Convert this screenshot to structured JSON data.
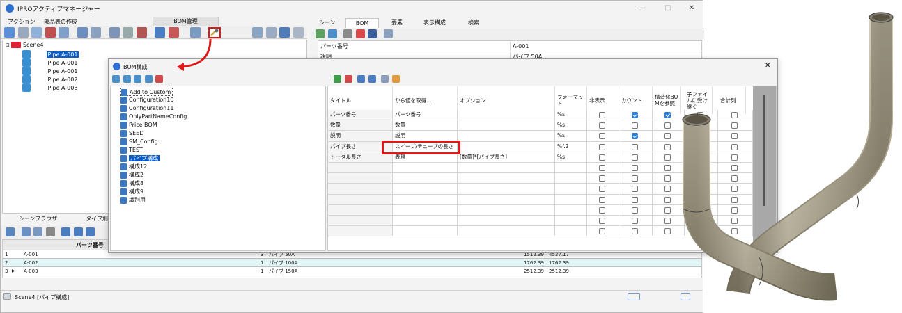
{
  "window": {
    "title": "IPROアクティブマネージャー",
    "controls": {
      "min": "—",
      "max": "□",
      "close": "✕"
    }
  },
  "menu": {
    "items": [
      "アクション",
      "部品表の作成"
    ],
    "bom_tab": "BOM管理"
  },
  "right_tabs": [
    "シーン",
    "BOM",
    "要素",
    "表示構成",
    "検索"
  ],
  "tree": {
    "root": "Scene4",
    "items": [
      "Pipe A-001",
      "Pipe A-001",
      "Pipe A-001",
      "Pipe A-002",
      "Pipe A-003"
    ]
  },
  "props": {
    "rows": [
      {
        "key": "パーツ番号",
        "value": "A-001"
      },
      {
        "key": "説明",
        "value": "パイプ 50A"
      }
    ]
  },
  "bottom_tabs": [
    "シーンブラウザ",
    "タイプ別"
  ],
  "grid": {
    "header": "パーツ番号",
    "rows": [
      {
        "no": "1",
        "part": "A-001",
        "qty": "3",
        "desc": "パイプ 50A",
        "len": "1512.39",
        "total": "4537.17"
      },
      {
        "no": "2",
        "part": "A-002",
        "qty": "1",
        "desc": "パイプ 100A",
        "len": "1762.39",
        "total": "1762.39"
      },
      {
        "no": "3",
        "part": "A-003",
        "qty": "1",
        "desc": "パイプ 150A",
        "len": "2512.39",
        "total": "2512.39"
      }
    ]
  },
  "status": {
    "text": "Scene4 [パイプ構成]"
  },
  "dialog": {
    "title": "BOM構成",
    "close": "✕",
    "configs": [
      "Add to Custom",
      "Configuration10",
      "Configuration11",
      "OnlyPartNameConfig",
      "Price BOM",
      "SEED",
      "SM_Config",
      "TEST",
      "パイプ構成",
      "構成12",
      "構成2",
      "構成8",
      "構成9",
      "識別用"
    ],
    "selected_config": "パイプ構成",
    "columns": [
      "タイトル",
      "から値を取得…",
      "オプション",
      "フォーマット",
      "非表示",
      "カウント",
      "構造化BOMを参照",
      "子ファイルに受け継ぐ",
      "合計列"
    ],
    "rows": [
      {
        "title": "パーツ番号",
        "source": "パーツ番号",
        "option": "",
        "format": "%s",
        "hide": false,
        "count": true,
        "struct": true,
        "child": false,
        "sum": false
      },
      {
        "title": "数量",
        "source": "数量",
        "option": "",
        "format": "%s",
        "hide": false,
        "count": false,
        "struct": false,
        "child": false,
        "sum": false
      },
      {
        "title": "説明",
        "source": "説明",
        "option": "",
        "format": "%s",
        "hide": false,
        "count": true,
        "struct": false,
        "child": false,
        "sum": false
      },
      {
        "title": "パイプ長さ",
        "source": "スイープ/チューブの長さ",
        "option": "",
        "format": "%f.2",
        "hide": false,
        "count": false,
        "struct": false,
        "child": false,
        "sum": false
      },
      {
        "title": "トータル長さ",
        "source": "表現",
        "option": "[数量]*[パイプ長さ]",
        "format": "%s",
        "hide": false,
        "count": false,
        "struct": false,
        "child": false,
        "sum": false
      }
    ],
    "empty_rows": 7
  },
  "colors": {
    "accent": "#2f7fd6",
    "highlight": "#e01818",
    "selection": "#0a5cc8",
    "row_alt": "#e2f6f8"
  }
}
